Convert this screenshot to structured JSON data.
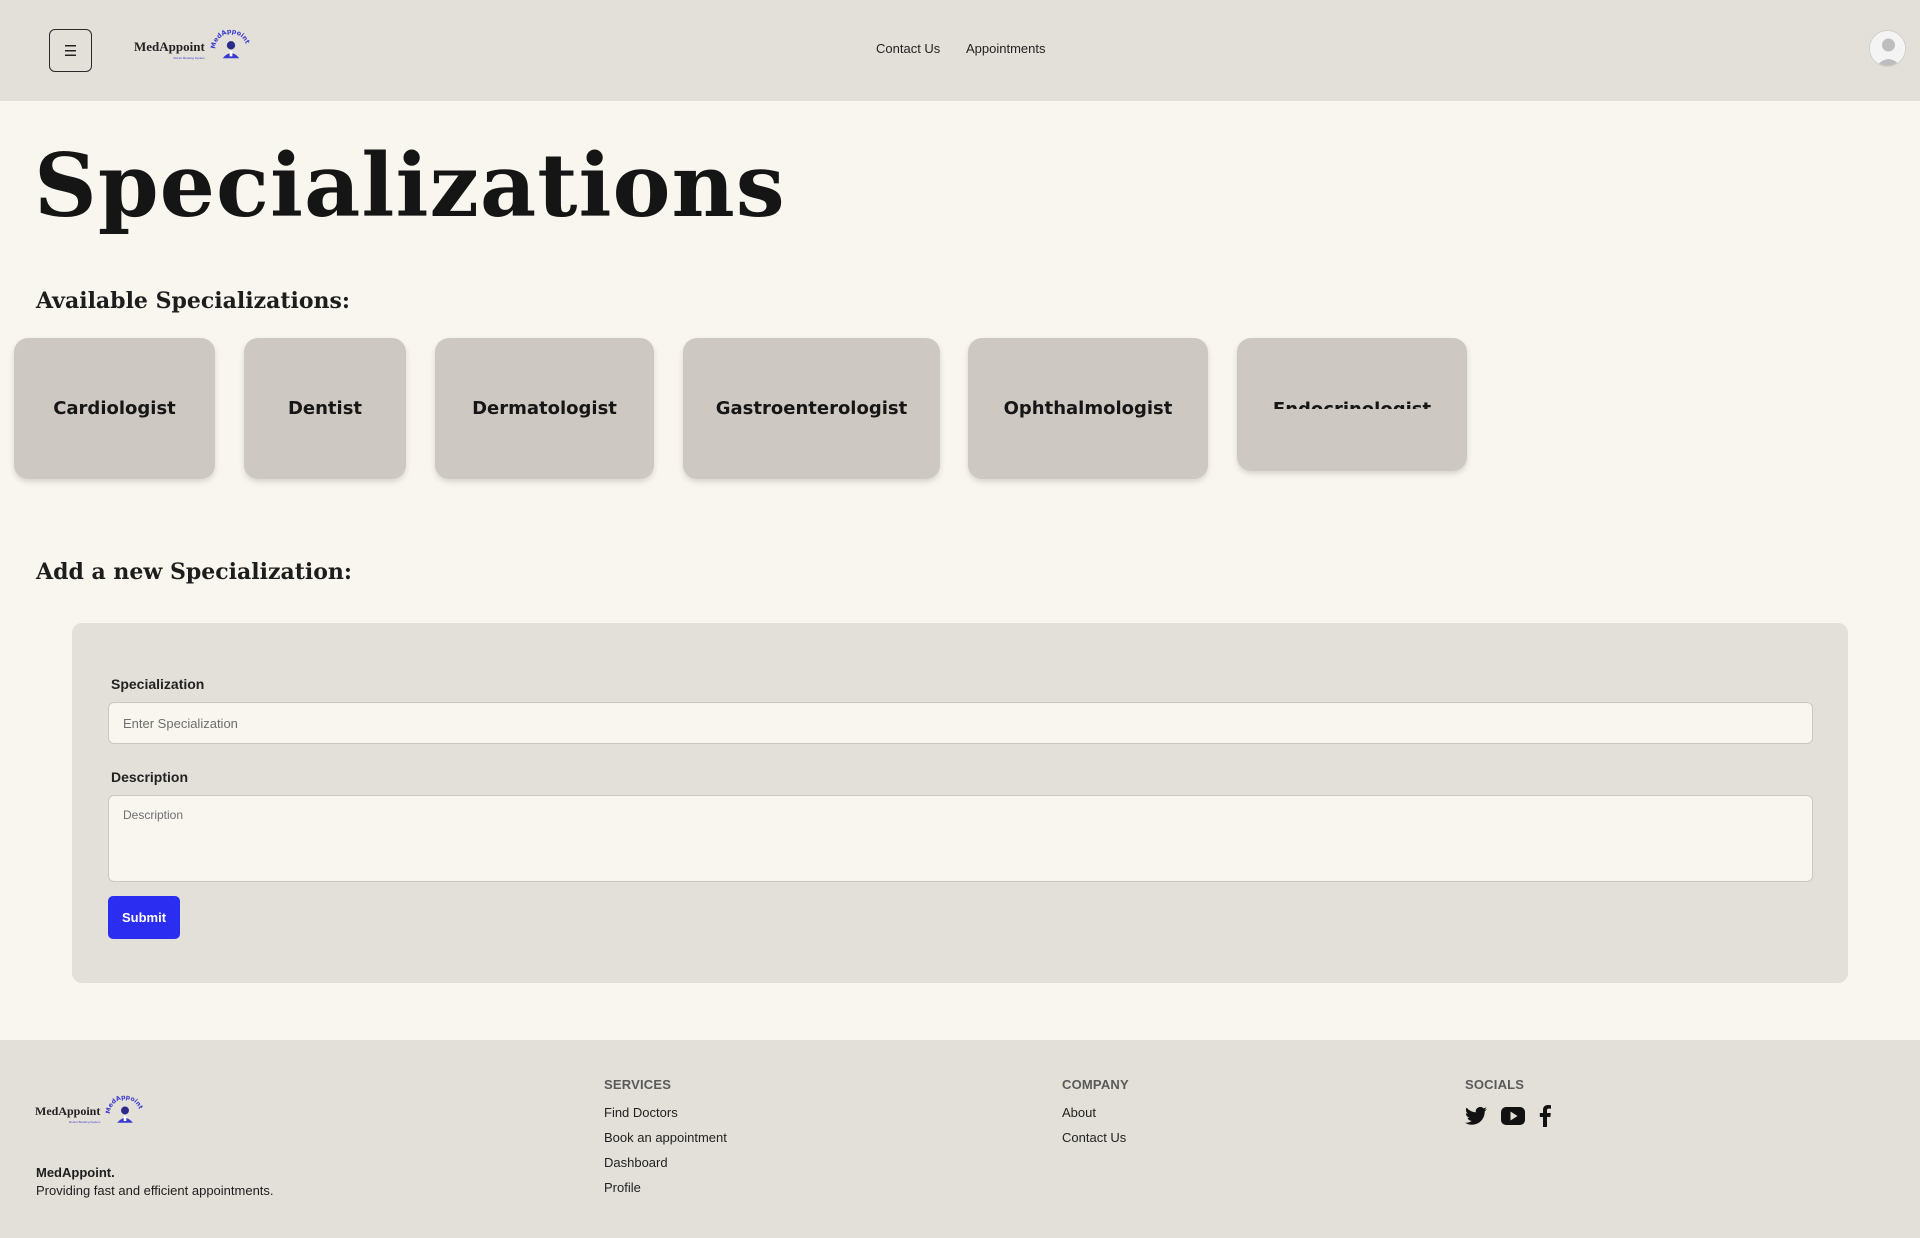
{
  "header": {
    "menu_icon": "☰",
    "logo_text": "MedAppoint",
    "logo_subtext": "Doctor Booking System",
    "badge_text": "MedAppoint",
    "nav": {
      "contact": "Contact Us",
      "appointments": "Appointments"
    },
    "avatar": "avatar-icon"
  },
  "main": {
    "title": "Specializations",
    "available_heading": "Available Specializations:",
    "specializations": [
      "Cardiologist",
      "Dentist",
      "Dermatologist",
      "Gastroenterologist",
      "Ophthalmologist",
      "Endocrinologist"
    ],
    "add_heading": "Add a new Specialization:"
  },
  "form": {
    "specialization_label": "Specialization",
    "specialization_placeholder": "Enter Specialization",
    "specialization_value": "",
    "description_label": "Description",
    "description_placeholder": "Description",
    "description_value": "",
    "submit_label": "Submit",
    "submit_color": "#2b2ef0"
  },
  "footer": {
    "logo_text": "MedAppoint",
    "logo_subtext": "Doctor Booking System",
    "badge_text": "MedAppoint",
    "brand_name": "MedAppoint.",
    "tagline": "Providing fast and efficient appointments.",
    "services": {
      "title": "SERVICES",
      "links": [
        "Find Doctors",
        "Book an appointment",
        "Dashboard",
        "Profile"
      ]
    },
    "company": {
      "title": "COMPANY",
      "links": [
        "About",
        "Contact Us"
      ]
    },
    "socials": {
      "title": "SOCIALS",
      "icons": [
        "twitter-icon",
        "youtube-icon",
        "facebook-icon"
      ]
    }
  },
  "colors": {
    "page_background": "#f8f6ef",
    "header_background": "#e3e0d9",
    "card_background": "#cdc9c2",
    "brand_blue": "#3a3ad0"
  }
}
